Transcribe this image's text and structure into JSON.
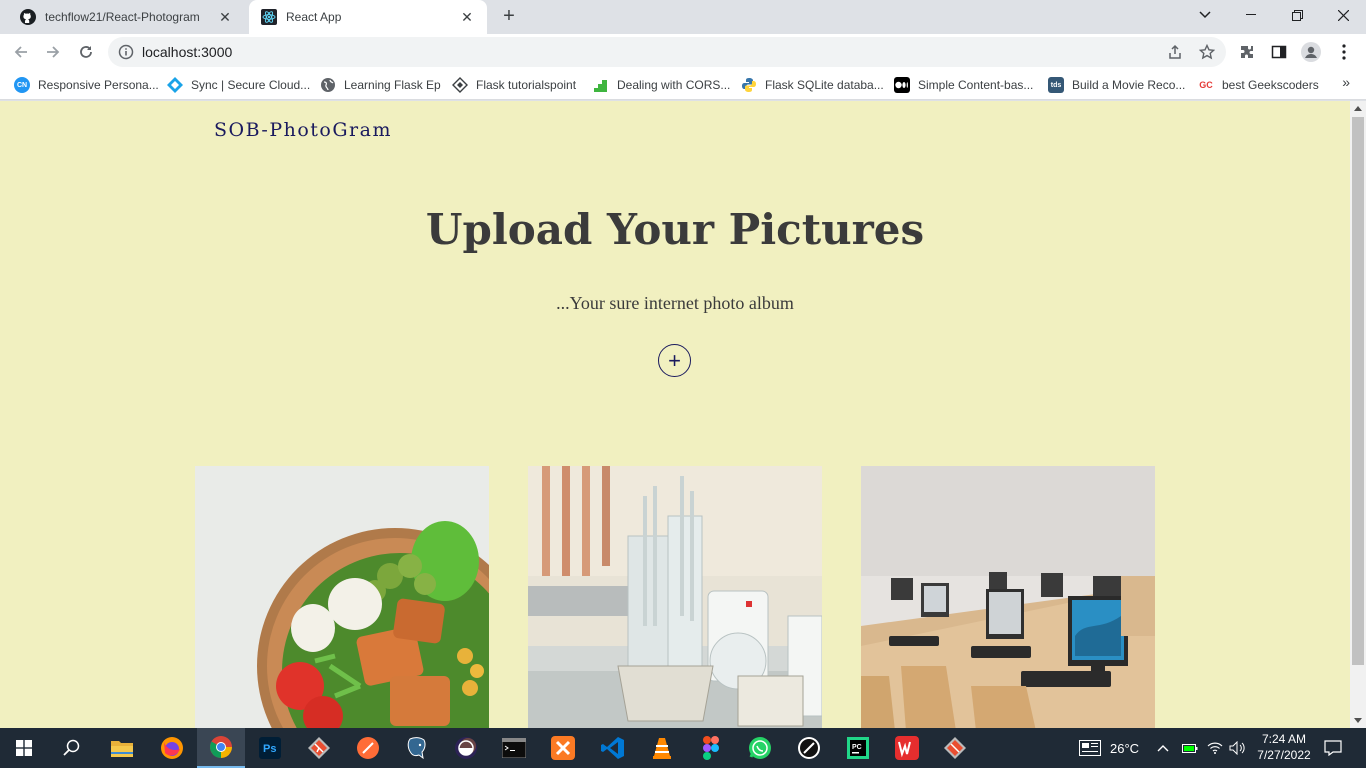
{
  "tabs": [
    {
      "title": "techflow21/React-Photogram",
      "icon": "github-icon",
      "active": false
    },
    {
      "title": "React App",
      "icon": "react-icon",
      "active": true
    }
  ],
  "address_bar": {
    "url": "localhost:3000"
  },
  "bookmarks": [
    {
      "label": "Responsive Persona...",
      "icon": "cn-icon",
      "color": "#2196f3"
    },
    {
      "label": "Sync | Secure Cloud...",
      "icon": "sync-icon",
      "color": "#1aa3e8"
    },
    {
      "label": "Learning Flask Ep",
      "icon": "globe-icon",
      "color": "#5f6368"
    },
    {
      "label": "Flask tutorialspoint",
      "icon": "tutorialspoint-icon",
      "color": "#3c4043"
    },
    {
      "label": "Dealing with CORS...",
      "icon": "stairs-icon",
      "color": "#3fb53f"
    },
    {
      "label": "Flask SQLite databa...",
      "icon": "python-icon",
      "color": "#3776ab"
    },
    {
      "label": "Simple Content-bas...",
      "icon": "medium-icon",
      "color": "#000000"
    },
    {
      "label": "Build a Movie Reco...",
      "icon": "tds-icon",
      "color": "#355876"
    },
    {
      "label": "best Geekscoders",
      "icon": "gc-icon",
      "color": "#e53935"
    }
  ],
  "page": {
    "brand": "SOB-PhotoGram",
    "title": "Upload Your Pictures",
    "subtitle": "...Your sure internet photo album",
    "upload_symbol": "+",
    "photos": [
      {
        "subject": "salad bowl"
      },
      {
        "subject": "laboratory glassware"
      },
      {
        "subject": "computer lab"
      }
    ]
  },
  "taskbar": {
    "apps": [
      "start-icon",
      "search-icon",
      "file-explorer-icon",
      "firefox-icon",
      "chrome-icon",
      "photoshop-icon",
      "git-icon",
      "postman-icon",
      "postgres-icon",
      "eclipse-icon",
      "terminal-icon",
      "xampp-icon",
      "vscode-icon",
      "vlc-icon",
      "figma-icon",
      "whatsapp-icon",
      "inkscape-icon",
      "pycharm-icon",
      "wps-icon",
      "git-gui-icon"
    ],
    "weather": "26°C",
    "time": "7:24 AM",
    "date": "7/27/2022"
  },
  "colors": {
    "page_bg": "#f1f0c0",
    "brand": "#1a1a5e",
    "heading": "#3b3b3b",
    "taskbar": "#1f2a36"
  }
}
